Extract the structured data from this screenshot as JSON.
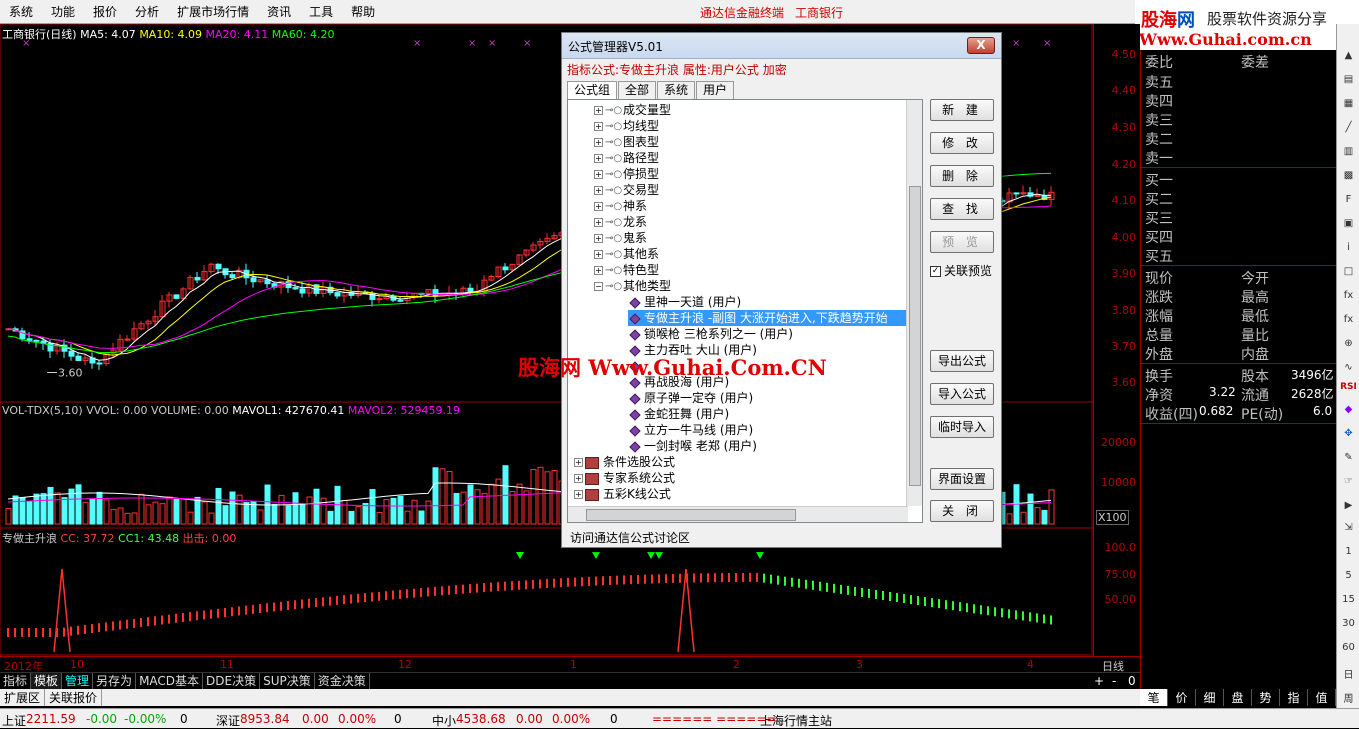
{
  "menu": [
    "系统",
    "功能",
    "报价",
    "分析",
    "扩展市场行情",
    "资讯",
    "工具",
    "帮助"
  ],
  "brand": [
    "通达信金融终端",
    "工商银行"
  ],
  "logo": {
    "name_a": "股海",
    "name_b": "网",
    "slogan": "股票软件资源分享",
    "url": "Www.Guhai.com.cn"
  },
  "chart": {
    "title": "工商银行(日线)",
    "ma5": "MA5: 4.07",
    "ma10": "MA10: 4.09",
    "ma20": "MA20: 4.11",
    "ma60": "MA60: 4.20",
    "low_mark": "3.60",
    "price_axis": [
      "4.50",
      "4.40",
      "4.30",
      "4.20",
      "4.10",
      "4.00",
      "3.90",
      "3.80",
      "3.70",
      "3.60"
    ],
    "vol_header": "VOL-TDX(5,10)",
    "vvol": "VVOL: 0.00",
    "volume": "VOLUME: 0.00",
    "mavol1": "MAVOL1: 427670.41",
    "mavol2": "MAVOL2: 529459.19",
    "vol_axis": [
      "20000",
      "10000"
    ],
    "vol_unit": "X100",
    "ind_name": "专做主升浪",
    "cc": "CC: 37.72",
    "cc1": "CC1: 43.48",
    "exit": "出击: 0.00",
    "ind_axis": [
      "100.0",
      "75.00",
      "50.00"
    ],
    "x_labels": [
      "2012年",
      "10",
      "11",
      "12",
      "1",
      "2",
      "3",
      "4"
    ],
    "period": "日线"
  },
  "quote_panel": {
    "header": [
      "委比",
      "委差"
    ],
    "sell": [
      "卖五",
      "卖四",
      "卖三",
      "卖二",
      "卖一"
    ],
    "buy": [
      "买一",
      "买二",
      "买三",
      "买四",
      "买五"
    ],
    "stats_left": [
      "现价",
      "涨跌",
      "涨幅",
      "总量",
      "外盘"
    ],
    "stats_right": [
      "今开",
      "最高",
      "最低",
      "量比",
      "内盘"
    ],
    "turnover_label": "换手",
    "capital_label": "股本",
    "capital_value": "3496亿",
    "nav_label": "净资",
    "nav_value": "3.22",
    "float_label": "流通",
    "float_value": "2628亿",
    "eps_label": "收益(四)",
    "eps_value": "0.682",
    "pe_label": "PE(动)",
    "pe_value": "6.0"
  },
  "bottom_tabs": [
    "指标",
    "模板",
    "管理",
    "另存为",
    "MACD基本",
    "DDE决策",
    "SUP决策",
    "资金决策"
  ],
  "bottom_tabs2": [
    "扩展区",
    "关联报价"
  ],
  "right_tabs": [
    "笔",
    "价",
    "细",
    "盘",
    "势",
    "指",
    "值",
    "筹"
  ],
  "nav_ctrls": [
    "+",
    "-",
    "0"
  ],
  "statusbar": {
    "sh_label": "上证",
    "sh_value": "2211.59",
    "sh_chg": "-0.00",
    "sh_pct": "-0.00%",
    "sh_vol": "0",
    "sz_label": "深证",
    "sz_value": "8953.84",
    "sz_chg": "0.00",
    "sz_pct": "0.00%",
    "sz_vol": "0",
    "zx_label": "中小",
    "zx_value": "4538.68",
    "zx_chg": "0.00",
    "zx_pct": "0.00%",
    "zx_vol": "0",
    "ticker": "====== ======",
    "station": "上海行情主站"
  },
  "dialog": {
    "title": "公式管理器V5.01",
    "close": "X",
    "info": "指标公式:专做主升浪  属性:用户公式  加密",
    "tabs": [
      "公式组",
      "全部",
      "系统",
      "用户"
    ],
    "tree": [
      {
        "label": "成交量型",
        "level": 1,
        "kind": "group"
      },
      {
        "label": "均线型",
        "level": 1,
        "kind": "group"
      },
      {
        "label": "图表型",
        "level": 1,
        "kind": "group"
      },
      {
        "label": "路径型",
        "level": 1,
        "kind": "group"
      },
      {
        "label": "停损型",
        "level": 1,
        "kind": "group"
      },
      {
        "label": "交易型",
        "level": 1,
        "kind": "group"
      },
      {
        "label": "神系",
        "level": 1,
        "kind": "group"
      },
      {
        "label": "龙系",
        "level": 1,
        "kind": "group"
      },
      {
        "label": "鬼系",
        "level": 1,
        "kind": "group"
      },
      {
        "label": "其他系",
        "level": 1,
        "kind": "group"
      },
      {
        "label": "特色型",
        "level": 1,
        "kind": "group"
      },
      {
        "label": "其他类型",
        "level": 1,
        "kind": "open"
      },
      {
        "label": "里神一天道   (用户)",
        "level": 2,
        "kind": "item"
      },
      {
        "label": "专做主升浪   -副图  大涨开始进入,下跌趋势开始",
        "level": 2,
        "kind": "item",
        "selected": true
      },
      {
        "label": "锁喉枪   三枪系列之一 (用户)",
        "level": 2,
        "kind": "item"
      },
      {
        "label": "主力吞吐   大山 (用户)",
        "level": 2,
        "kind": "item"
      },
      {
        "label": "",
        "level": 2,
        "kind": "item"
      },
      {
        "label": "再战股海   (用户)",
        "level": 2,
        "kind": "item"
      },
      {
        "label": "原子弹一定夺 (用户)",
        "level": 2,
        "kind": "item"
      },
      {
        "label": "金蛇狂舞   (用户)",
        "level": 2,
        "kind": "item"
      },
      {
        "label": "立方一牛马线   (用户)",
        "level": 2,
        "kind": "item"
      },
      {
        "label": "一剑封喉   老郑 (用户)",
        "level": 2,
        "kind": "item"
      },
      {
        "label": "条件选股公式",
        "level": 0,
        "kind": "book"
      },
      {
        "label": "专家系统公式",
        "level": 0,
        "kind": "book"
      },
      {
        "label": "五彩K线公式",
        "level": 0,
        "kind": "book"
      }
    ],
    "buttons": [
      "新 建",
      "修 改",
      "删 除",
      "查 找",
      "预 览"
    ],
    "buttons2": [
      "导出公式",
      "导入公式",
      "临时导入",
      "界面设置",
      "关 闭"
    ],
    "preview_check": "关联预览",
    "forum_link": "访问通达信公式讨论区"
  },
  "watermark": "股海网 Www.Guhai.Com.CN",
  "colors": {
    "up": "#ff3030",
    "down": "#54ffff",
    "ma5": "#ffffff",
    "ma10": "#ffff00",
    "ma20": "#ff00ff",
    "ma60": "#00ff00",
    "axis": "#a00000"
  }
}
